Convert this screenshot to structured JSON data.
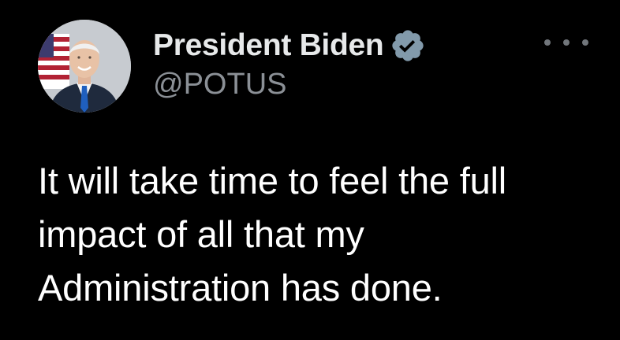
{
  "tweet": {
    "author": {
      "display_name": "President Biden",
      "handle": "@POTUS",
      "verified_icon": "verified-badge-icon",
      "avatar_icon": "profile-photo"
    },
    "more_icon": "more-options-icon",
    "text_lines": [
      "It will take time to feel the full",
      "impact of all that my",
      "Administration has done."
    ],
    "colors": {
      "background": "#000000",
      "primary_text": "#e7e9ea",
      "secondary_text": "#8b9096",
      "verified_badge": "#829aab"
    }
  }
}
